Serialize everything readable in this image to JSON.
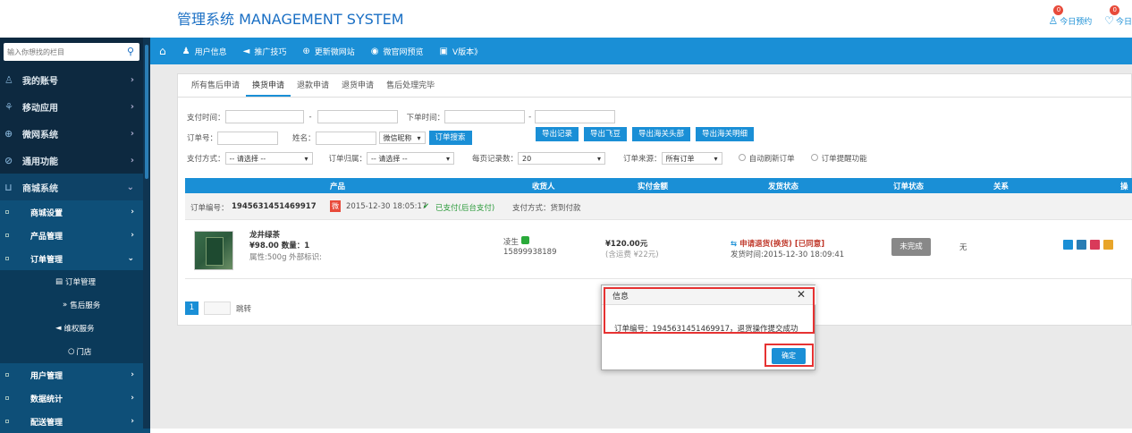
{
  "topbar": {
    "title": "管理系统 MANAGEMENT SYSTEM",
    "badges": [
      {
        "icon": "user-icon",
        "count": "0",
        "label": "今日预约"
      },
      {
        "icon": "chat-icon",
        "count": "0",
        "label": "今日"
      }
    ]
  },
  "sidebar": {
    "search_placeholder": "输入你想找的栏目",
    "items": [
      {
        "icon": "account-icon",
        "label": "我的账号",
        "arrow": "›"
      },
      {
        "icon": "apps-icon",
        "label": "移动应用",
        "arrow": "›"
      },
      {
        "icon": "globe-icon",
        "label": "微网系统",
        "arrow": "›"
      },
      {
        "icon": "tools-icon",
        "label": "通用功能",
        "arrow": "›"
      },
      {
        "icon": "cart-icon",
        "label": "商城系统",
        "arrow": "⌄"
      }
    ],
    "sub_items": [
      {
        "label": "商城设置",
        "arrow": "›"
      },
      {
        "label": "产品管理",
        "arrow": "›"
      },
      {
        "label": "订单管理",
        "arrow": "⌄"
      }
    ],
    "subsub_items": [
      {
        "icon": "doc-icon",
        "label": "订单管理"
      },
      {
        "icon": "double-chevron-icon",
        "label": "售后服务"
      },
      {
        "icon": "megaphone-icon",
        "label": "维权服务"
      },
      {
        "icon": "store-icon",
        "label": "门店"
      }
    ],
    "bottom_items": [
      {
        "label": "用户管理",
        "arrow": "›"
      },
      {
        "label": "数据统计",
        "arrow": "›"
      },
      {
        "label": "配送管理",
        "arrow": "›"
      }
    ]
  },
  "navbar": {
    "items": [
      {
        "icon": "home-icon",
        "label": ""
      },
      {
        "icon": "user-icon",
        "label": "用户信息"
      },
      {
        "icon": "megaphone-icon",
        "label": "推广技巧"
      },
      {
        "icon": "globe-icon",
        "label": "更新微网站"
      },
      {
        "icon": "eye-icon",
        "label": "微官网预览"
      },
      {
        "icon": "version-icon",
        "label": "V版本》"
      }
    ]
  },
  "tabs": [
    "所有售后申请",
    "换货申请",
    "退款申请",
    "退货申请",
    "售后处理完毕"
  ],
  "filters": {
    "pay_time_label": "支付时间：",
    "dash": "-",
    "order_time_label": "下单时间：",
    "order_no_label": "订单号：",
    "name_label": "姓名：",
    "nickname_select": "微信昵称",
    "search_button": "订单搜索",
    "export_buttons": [
      "导出记录",
      "导出飞豆",
      "导出海关头部",
      "导出海关明细"
    ],
    "pay_method_label": "支付方式：",
    "pay_method_value": "-- 请选择 --",
    "order_owner_label": "订单归属：",
    "order_owner_value": "-- 请选择 --",
    "per_page_label": "每页记录数：",
    "per_page_value": "20",
    "source_label": "订单来源：",
    "source_value": "所有订单",
    "auto_refresh_label": "自动刷新订单",
    "remind_label": "订单提醒功能"
  },
  "table": {
    "headers": [
      "产品",
      "收货人",
      "实付金额",
      "发货状态",
      "订单状态",
      "关系",
      "操"
    ]
  },
  "order": {
    "number_label": "订单编号：",
    "number": "1945631451469917",
    "tag": "微",
    "datetime": "2015-12-30 18:05:17",
    "paid_status": "已支付(后台支付)",
    "pay_method": "支付方式：货到付款",
    "product_name": "龙井绿茶",
    "price_qty_prefix": "¥98.00 数量：",
    "qty": "1",
    "attrs": "属性:500g 外部标识:",
    "receiver_name": "凌生",
    "receiver_phone": "15899938189",
    "amount": "¥120.00元",
    "shipping_fee": "(含运费 ¥22元)",
    "ship_status": "申请退货(换货) [已同意]",
    "ship_time": "发货时间:2015-12-30 18:09:41",
    "order_status": "未完成",
    "relation": "无"
  },
  "pager": {
    "page": "1",
    "jump": "跳转"
  },
  "dialog": {
    "title": "信息",
    "close": "✕",
    "message": "订单编号：1945631451469917，退货操作提交成功",
    "ok": "确定"
  }
}
